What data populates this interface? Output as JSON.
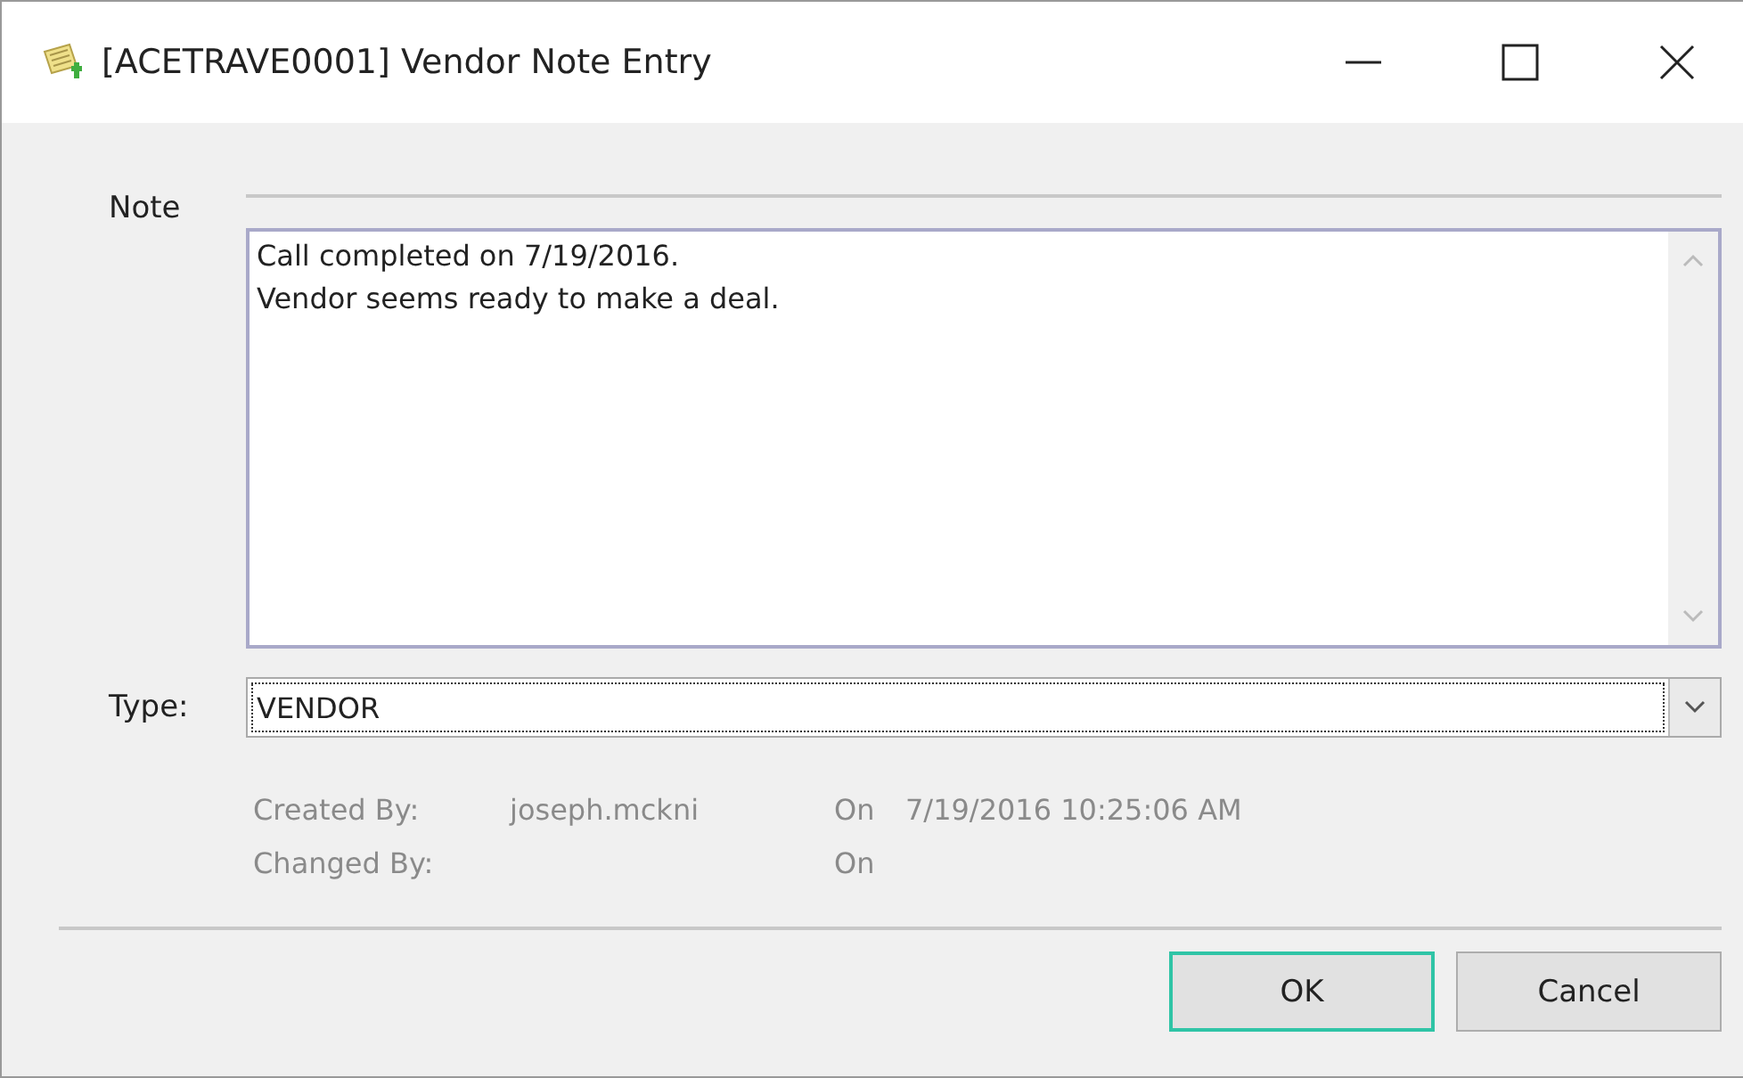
{
  "window": {
    "title": "[ACETRAVE0001] Vendor Note Entry"
  },
  "note": {
    "label": "Note",
    "lines": [
      "Call completed on 7/19/2016.",
      "Vendor seems ready to make a deal."
    ]
  },
  "type": {
    "label": "Type:",
    "value": "VENDOR"
  },
  "info": [
    {
      "label": "Created By:",
      "user": "joseph.mckni",
      "on_label": "On",
      "date": "7/19/2016 10:25:06 AM"
    },
    {
      "label": "Changed By:",
      "on_label": "On"
    }
  ],
  "buttons": [
    {
      "label": "OK",
      "default": true
    },
    {
      "label": "Cancel",
      "default": false
    }
  ]
}
